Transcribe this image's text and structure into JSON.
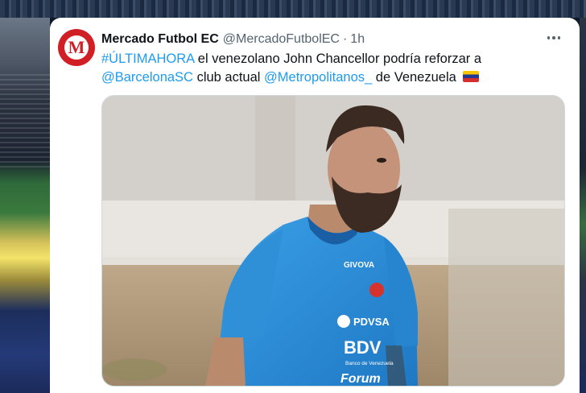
{
  "tweet": {
    "display_name": "Mercado Futbol EC",
    "handle": "@MercadoFutbolEC",
    "separator": "·",
    "time": "1h",
    "avatar_letter": "M",
    "text_parts": {
      "hashtag": "#ÚLTIMAHORA",
      "text1": " el venezolano John Chancellor podría reforzar a ",
      "mention1": "@BarcelonaSC",
      "text2": " club actual ",
      "mention2": "@Metropolitanos_",
      "text3": " de Venezuela "
    },
    "flag_icon": "venezuela-flag-icon",
    "media": {
      "jersey_brand": "GIVOVA",
      "sponsor1": "PDVSA",
      "sponsor2": "BDV",
      "sponsor2_sub": "Banco de Venezuela",
      "sponsor3": "Forum"
    }
  },
  "colors": {
    "link": "#1d9bf0",
    "avatar_red": "#d11f26",
    "jersey_blue": "#2e8fd6"
  }
}
